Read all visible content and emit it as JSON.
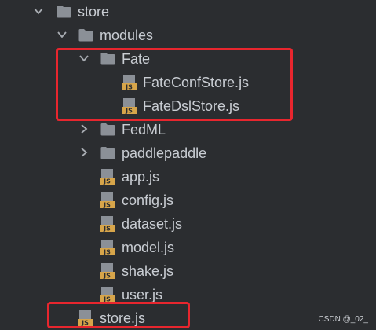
{
  "tree": {
    "store": "store",
    "modules": "modules",
    "fate": "Fate",
    "fate_conf_store": "FateConfStore.js",
    "fate_dsl_store": "FateDslStore.js",
    "fedml": "FedML",
    "paddlepaddle": "paddlepaddle",
    "app": "app.js",
    "config": "config.js",
    "dataset": "dataset.js",
    "model": "model.js",
    "shake": "shake.js",
    "user": "user.js",
    "store_js": "store.js"
  },
  "icons": {
    "folder": "folder-icon",
    "js_file": "js-file-icon",
    "expanded": "chevron-down-icon",
    "collapsed": "chevron-right-icon"
  },
  "colors": {
    "background": "#2b2d30",
    "highlight_border": "#e8262e",
    "folder": "#8b9097",
    "js_icon": "#d7a54a"
  },
  "watermark": "CSDN @_02_"
}
